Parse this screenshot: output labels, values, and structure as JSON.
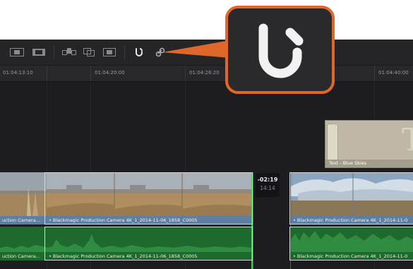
{
  "toolbar": {
    "icons": [
      "overwrite-clip-icon",
      "filmstrip-icon",
      "insert-clip-icon",
      "replace-clip-icon",
      "fit-to-fill-icon",
      "snapping-magnet-icon",
      "link-clips-icon"
    ]
  },
  "ruler": {
    "timecodes": [
      "01:04:13:10",
      "01:04:20:00",
      "01:04:26:20",
      "01:04:40:00"
    ]
  },
  "timeline": {
    "title_clip": {
      "label": "Text - Blue Skies"
    },
    "video_clips": [
      {
        "label": "uction Camera..."
      },
      {
        "label": "• Blackmagic Production Camera 4K_1_2014-11-06_1858_C0005"
      },
      {
        "label": "• Blackmagic Production Camera 4K_1_2014-11-0"
      }
    ],
    "audio_clips": [
      {
        "label": "uction Camera..."
      },
      {
        "label": "• Blackmagic Production Camera 4K_1_2014-11-06_1858_C0005"
      },
      {
        "label": "• Blackmagic Production Camera 4K_1_2014-11-0"
      }
    ],
    "gap_tooltip": {
      "delta": "-02:19",
      "duration": "14:14"
    }
  },
  "callout": {
    "icon": "snapping-magnet-icon",
    "border_color": "#e0672a"
  },
  "colors": {
    "video_clip": "#6b8fb3",
    "audio_clip": "#1e6a2e",
    "playhead_edit": "#35d14a"
  }
}
